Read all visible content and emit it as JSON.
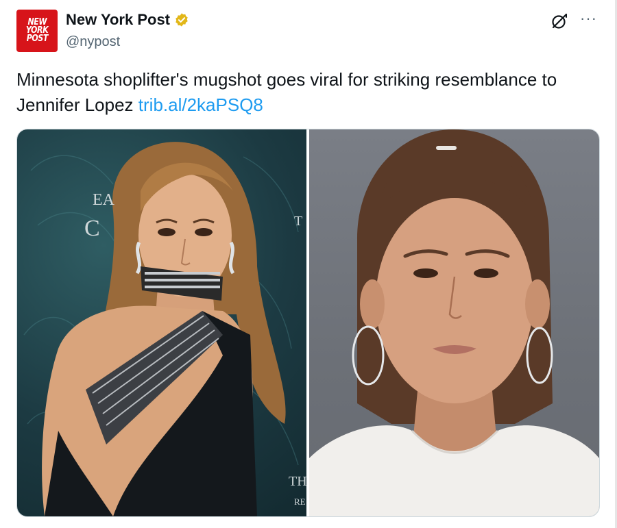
{
  "author": {
    "name": "New York Post",
    "handle": "@nypost",
    "avatar_lines": [
      "NEW",
      "YORK",
      "POST"
    ],
    "verified_color": "#e2b719",
    "avatar_color": "#d7141a"
  },
  "icons": {
    "grok": "grok-icon",
    "more": "more-icon",
    "more_glyph": "···",
    "verified": "verified-badge-icon"
  },
  "tweet": {
    "text": "Minnesota shoplifter's mugshot goes viral for striking resemblance to Jennifer Lopez ",
    "link_text": "trib.al/2kaPSQ8",
    "link_color": "#1d9bf0"
  },
  "media": {
    "left_photo": {
      "backdrop_text": [
        "EA",
        "C",
        "T",
        "TH",
        "RE"
      ]
    },
    "right_photo": {
      "backdrop_color": "#6c7077"
    }
  }
}
